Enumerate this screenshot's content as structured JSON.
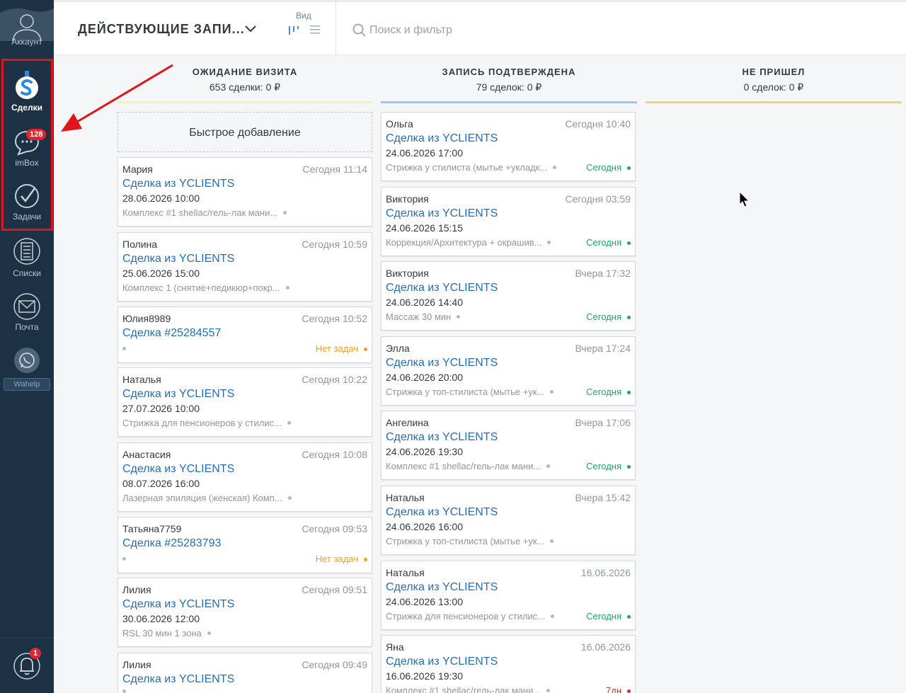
{
  "sidebar": {
    "account_label": "Аккаунт",
    "deals_label": "Сделки",
    "imbox_label": "imBox",
    "imbox_badge": "128",
    "tasks_label": "Задачи",
    "lists_label": "Списки",
    "mail_label": "Почта",
    "wahelp_label": "Wahelp",
    "notifications_badge": "1",
    "highlight_color": "#e0141b"
  },
  "header": {
    "pipeline_title": "ДЕЙСТВУЮЩИЕ ЗАПИ...",
    "view_label": "Вид",
    "search_placeholder": "Поиск и фильтр"
  },
  "columns": [
    {
      "title": "ОЖИДАНИЕ ВИЗИТА",
      "summary": "653 сделки: 0 ₽",
      "color": "#f7f1a8"
    },
    {
      "title": "ЗАПИСЬ ПОДТВЕРЖДЕНА",
      "summary": "79 сделок: 0 ₽",
      "color": "#99c6f2"
    },
    {
      "title": "НЕ ПРИШЕЛ",
      "summary": "0 сделок: 0 ₽",
      "color": "#f7cf6e"
    }
  ],
  "quick_add_label": "Быстрое добавление",
  "col1_cards": [
    {
      "name": "Мария",
      "time": "Сегодня 11:14",
      "deal": "Сделка из YCLIENTS",
      "date": "28.06.2026 10:00",
      "service": "Комплекс #1 shellac/гель-лак мани...",
      "task": ""
    },
    {
      "name": "Полина",
      "time": "Сегодня 10:59",
      "deal": "Сделка из YCLIENTS",
      "date": "25.06.2026 15:00",
      "service": "Комплекс 1 (снятие+педикюр+покр...",
      "task": ""
    },
    {
      "name": "Юлия8989",
      "time": "Сегодня 10:52",
      "deal": "Сделка #25284557",
      "date": "",
      "service": "",
      "task": "Нет задач"
    },
    {
      "name": "Наталья",
      "time": "Сегодня 10:22",
      "deal": "Сделка из YCLIENTS",
      "date": "27.07.2026 10:00",
      "service": "Стрижка для пенсионеров у стилис...",
      "task": ""
    },
    {
      "name": "Анастасия",
      "time": "Сегодня 10:08",
      "deal": "Сделка из YCLIENTS",
      "date": "08.07.2026 16:00",
      "service": "Лазерная эпиляция (женская) Комп...",
      "task": ""
    },
    {
      "name": "Татьяна7759",
      "time": "Сегодня 09:53",
      "deal": "Сделка #25283793",
      "date": "",
      "service": "",
      "task": "Нет задач"
    },
    {
      "name": "Лилия",
      "time": "Сегодня 09:51",
      "deal": "Сделка из YCLIENTS",
      "date": "30.06.2026 12:00",
      "service": "RSL 30 мин 1 зона",
      "task": ""
    },
    {
      "name": "Лилия",
      "time": "Сегодня 09:49",
      "deal": "Сделка из YCLIENTS",
      "date": "",
      "service": "",
      "task": ""
    }
  ],
  "col2_cards": [
    {
      "name": "Ольга",
      "time": "Сегодня 10:40",
      "deal": "Сделка из YCLIENTS",
      "date": "24.06.2026 17:00",
      "service": "Стрижка у стилиста (мытье +укладк...",
      "task": "Сегодня"
    },
    {
      "name": "Виктория",
      "time": "Сегодня 03:59",
      "deal": "Сделка из YCLIENTS",
      "date": "24.06.2026 15:15",
      "service": "Коррекция/Архитектура + окрашив...",
      "task": "Сегодня"
    },
    {
      "name": "Виктория",
      "time": "Вчера 17:32",
      "deal": "Сделка из YCLIENTS",
      "date": "24.06.2026 14:40",
      "service": "Массаж 30 мин",
      "task": "Сегодня"
    },
    {
      "name": "Элла",
      "time": "Вчера 17:24",
      "deal": "Сделка из YCLIENTS",
      "date": "24.06.2026 20:00",
      "service": "Стрижка у топ-стилиста (мытье +ук...",
      "task": "Сегодня"
    },
    {
      "name": "Ангелина",
      "time": "Вчера 17:06",
      "deal": "Сделка из YCLIENTS",
      "date": "24.06.2026 19:30",
      "service": "Комплекс #1 shellac/гель-лак мани...",
      "task": "Сегодня"
    },
    {
      "name": "Наталья",
      "time": "Вчера 15:42",
      "deal": "Сделка из YCLIENTS",
      "date": "24.06.2026 16:00",
      "service": "Стрижка у топ-стилиста (мытье +ук...",
      "task": ""
    },
    {
      "name": "Наталья",
      "time": "16.06.2026",
      "deal": "Сделка из YCLIENTS",
      "date": "24.06.2026 13:00",
      "service": "Стрижка для пенсионеров у стилис...",
      "task": "Сегодня"
    },
    {
      "name": "Яна",
      "time": "16.06.2026",
      "deal": "Сделка из YCLIENTS",
      "date": "16.06.2026 19:30",
      "service": "Комплекс #1 shellac/гель-лак мани...",
      "task": "7дн"
    }
  ]
}
